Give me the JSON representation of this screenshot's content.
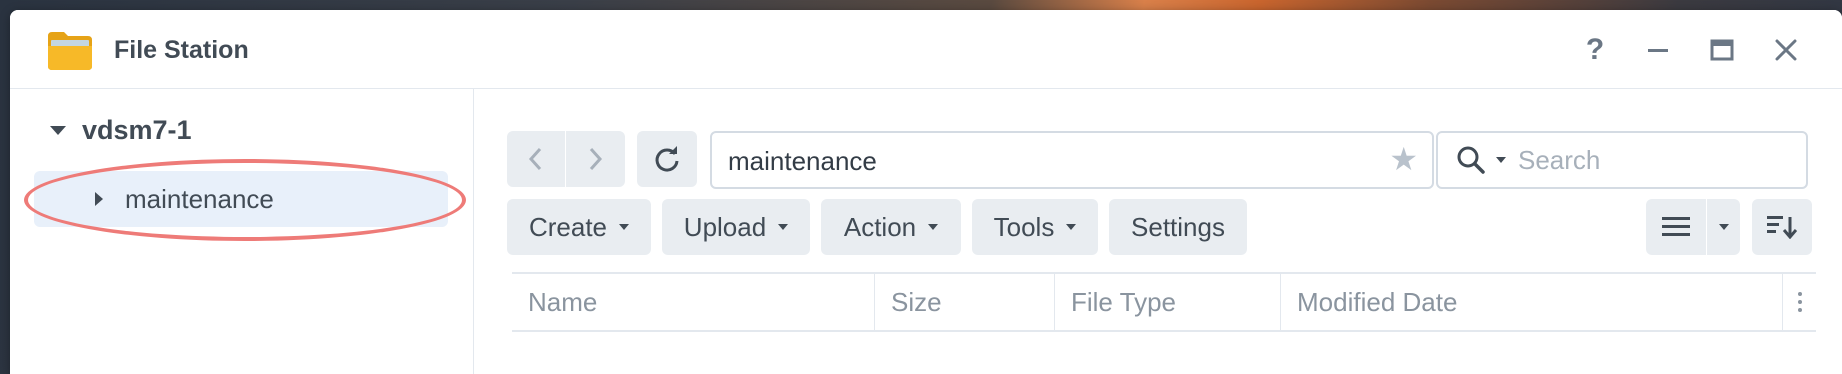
{
  "window": {
    "title": "File Station",
    "app_icon": "folder-icon",
    "controls": {
      "help": "?",
      "minimize": "minimize-icon",
      "maximize": "maximize-icon",
      "close": "close-icon"
    }
  },
  "sidebar": {
    "root": {
      "label": "vdsm7-1",
      "expanded": true
    },
    "items": [
      {
        "label": "maintenance",
        "selected": true,
        "expanded": false
      }
    ]
  },
  "toolbar": {
    "path": "maintenance",
    "search_placeholder": "Search",
    "buttons": {
      "create": "Create",
      "upload": "Upload",
      "action": "Action",
      "tools": "Tools",
      "settings": "Settings"
    }
  },
  "table": {
    "columns": [
      "Name",
      "Size",
      "File Type",
      "Modified Date"
    ],
    "rows": []
  },
  "colors": {
    "accent_highlight": "#e8f0fa",
    "annotation": "#ee7b78",
    "button_bg": "#e9edf1",
    "text": "#414b55"
  }
}
